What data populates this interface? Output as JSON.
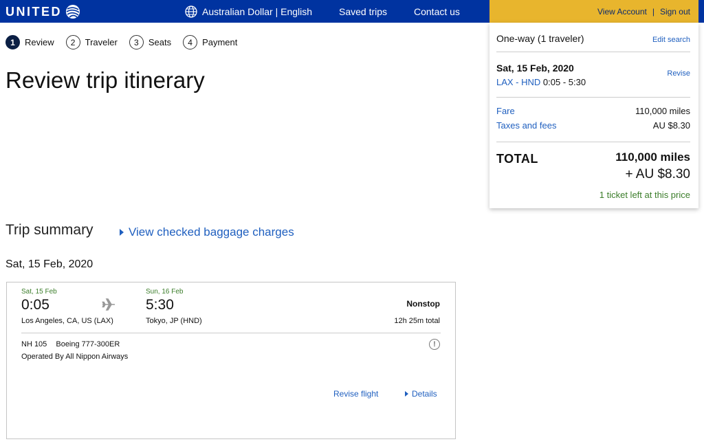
{
  "header": {
    "logo": "UNITED",
    "language": "Australian Dollar | English",
    "saved_trips": "Saved trips",
    "contact_us": "Contact us",
    "view_account": "View Account",
    "separator": "|",
    "sign_out": "Sign out"
  },
  "stepper": {
    "steps": [
      {
        "num": "1",
        "label": "Review",
        "active": true
      },
      {
        "num": "2",
        "label": "Traveler",
        "active": false
      },
      {
        "num": "3",
        "label": "Seats",
        "active": false
      },
      {
        "num": "4",
        "label": "Payment",
        "active": false
      }
    ]
  },
  "page_title": "Review trip itinerary",
  "summary": {
    "trip_type": "One-way (1 traveler)",
    "edit_search": "Edit search",
    "date": "Sat, 15 Feb, 2020",
    "route": "LAX - HND",
    "times": "0:05 - 5:30",
    "revise": "Revise",
    "fare_label": "Fare",
    "fare_value": "110,000 miles",
    "taxes_label": "Taxes and fees",
    "taxes_value": "AU $8.30",
    "total_label": "TOTAL",
    "total_miles": "110,000 miles",
    "total_cash": "+ AU $8.30",
    "ticket_left": "1 ticket left at this price"
  },
  "trip_summary": {
    "title": "Trip summary",
    "baggage_link": "View checked baggage charges",
    "date": "Sat, 15 Feb, 2020"
  },
  "flight": {
    "depart_date": "Sat, 15 Feb",
    "depart_time": "0:05",
    "depart_city": "Los Angeles, CA, US (LAX)",
    "arrive_date": "Sun, 16 Feb",
    "arrive_time": "5:30",
    "arrive_city": "Tokyo, JP (HND)",
    "stops": "Nonstop",
    "duration": "12h 25m total",
    "flight_number": "NH 105",
    "aircraft": "Boeing 777-300ER",
    "operated_by": "Operated By All Nippon Airways",
    "info_glyph": "!",
    "revise_flight": "Revise flight",
    "details": "Details"
  },
  "colors": {
    "brand_blue": "#0033a0",
    "account_gold": "#e8b52d",
    "link_blue": "#1f5fbf",
    "green": "#3b7d2a"
  },
  "icons": [
    "globe-icon",
    "airplane-icon",
    "info-icon",
    "caret-right-icon"
  ]
}
